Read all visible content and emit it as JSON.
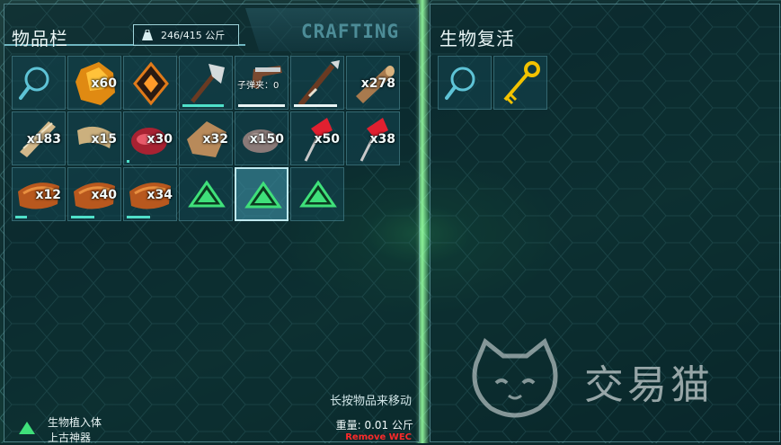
{
  "inventory": {
    "title": "物品栏",
    "weight_display": "246/415 公斤",
    "crafting_tab": "CRAFTING",
    "slots": [
      {
        "icon": "magnifier-icon",
        "qty": ""
      },
      {
        "icon": "amber-ore-icon",
        "qty": "x60"
      },
      {
        "icon": "artifact-icon",
        "qty": ""
      },
      {
        "icon": "hatchet-icon",
        "qty": "",
        "durability": 0.85
      },
      {
        "icon": "pistol-icon",
        "ammo": "子弹夹：0",
        "durability": 0.95
      },
      {
        "icon": "spear-icon",
        "qty": "",
        "durability": 0.9
      },
      {
        "icon": "wood-icon",
        "qty": "x278"
      },
      {
        "icon": "fiber-icon",
        "qty": "x183"
      },
      {
        "icon": "thatch-icon",
        "qty": "x15"
      },
      {
        "icon": "raw-meat-icon",
        "qty": "x30",
        "durability": 0.05
      },
      {
        "icon": "hide-icon",
        "qty": "x32"
      },
      {
        "icon": "stone-icon",
        "qty": "x150"
      },
      {
        "icon": "red-berry-arrow-icon",
        "qty": "x50"
      },
      {
        "icon": "red-berry-arrow-icon",
        "qty": "x38"
      },
      {
        "icon": "cooked-meat-icon",
        "qty": "x12",
        "durability": 0.25
      },
      {
        "icon": "cooked-meat-icon",
        "qty": "x40",
        "durability": 0.5
      },
      {
        "icon": "cooked-meat-icon",
        "qty": "x34",
        "durability": 0.5
      },
      {
        "icon": "implant-icon",
        "qty": ""
      },
      {
        "icon": "implant-icon",
        "qty": "",
        "selected": true
      },
      {
        "icon": "implant-icon",
        "qty": ""
      }
    ],
    "hint": "长按物品来移动",
    "selected_item": {
      "icon": "implant-icon",
      "name_line1": "生物植入体",
      "name_line2": "上古神器",
      "weight": "重量: 0.01 公斤",
      "remove": "Remove WEC"
    }
  },
  "revive": {
    "title": "生物复活",
    "slots": [
      {
        "icon": "magnifier-icon"
      },
      {
        "icon": "golden-key-icon"
      }
    ]
  },
  "watermark": {
    "text": "交易猫"
  },
  "colors": {
    "accent": "#4fe0c9",
    "panel_border": "#96dce6",
    "remove_red": "#ff2a2a",
    "implant_green": "#3fe07a"
  }
}
